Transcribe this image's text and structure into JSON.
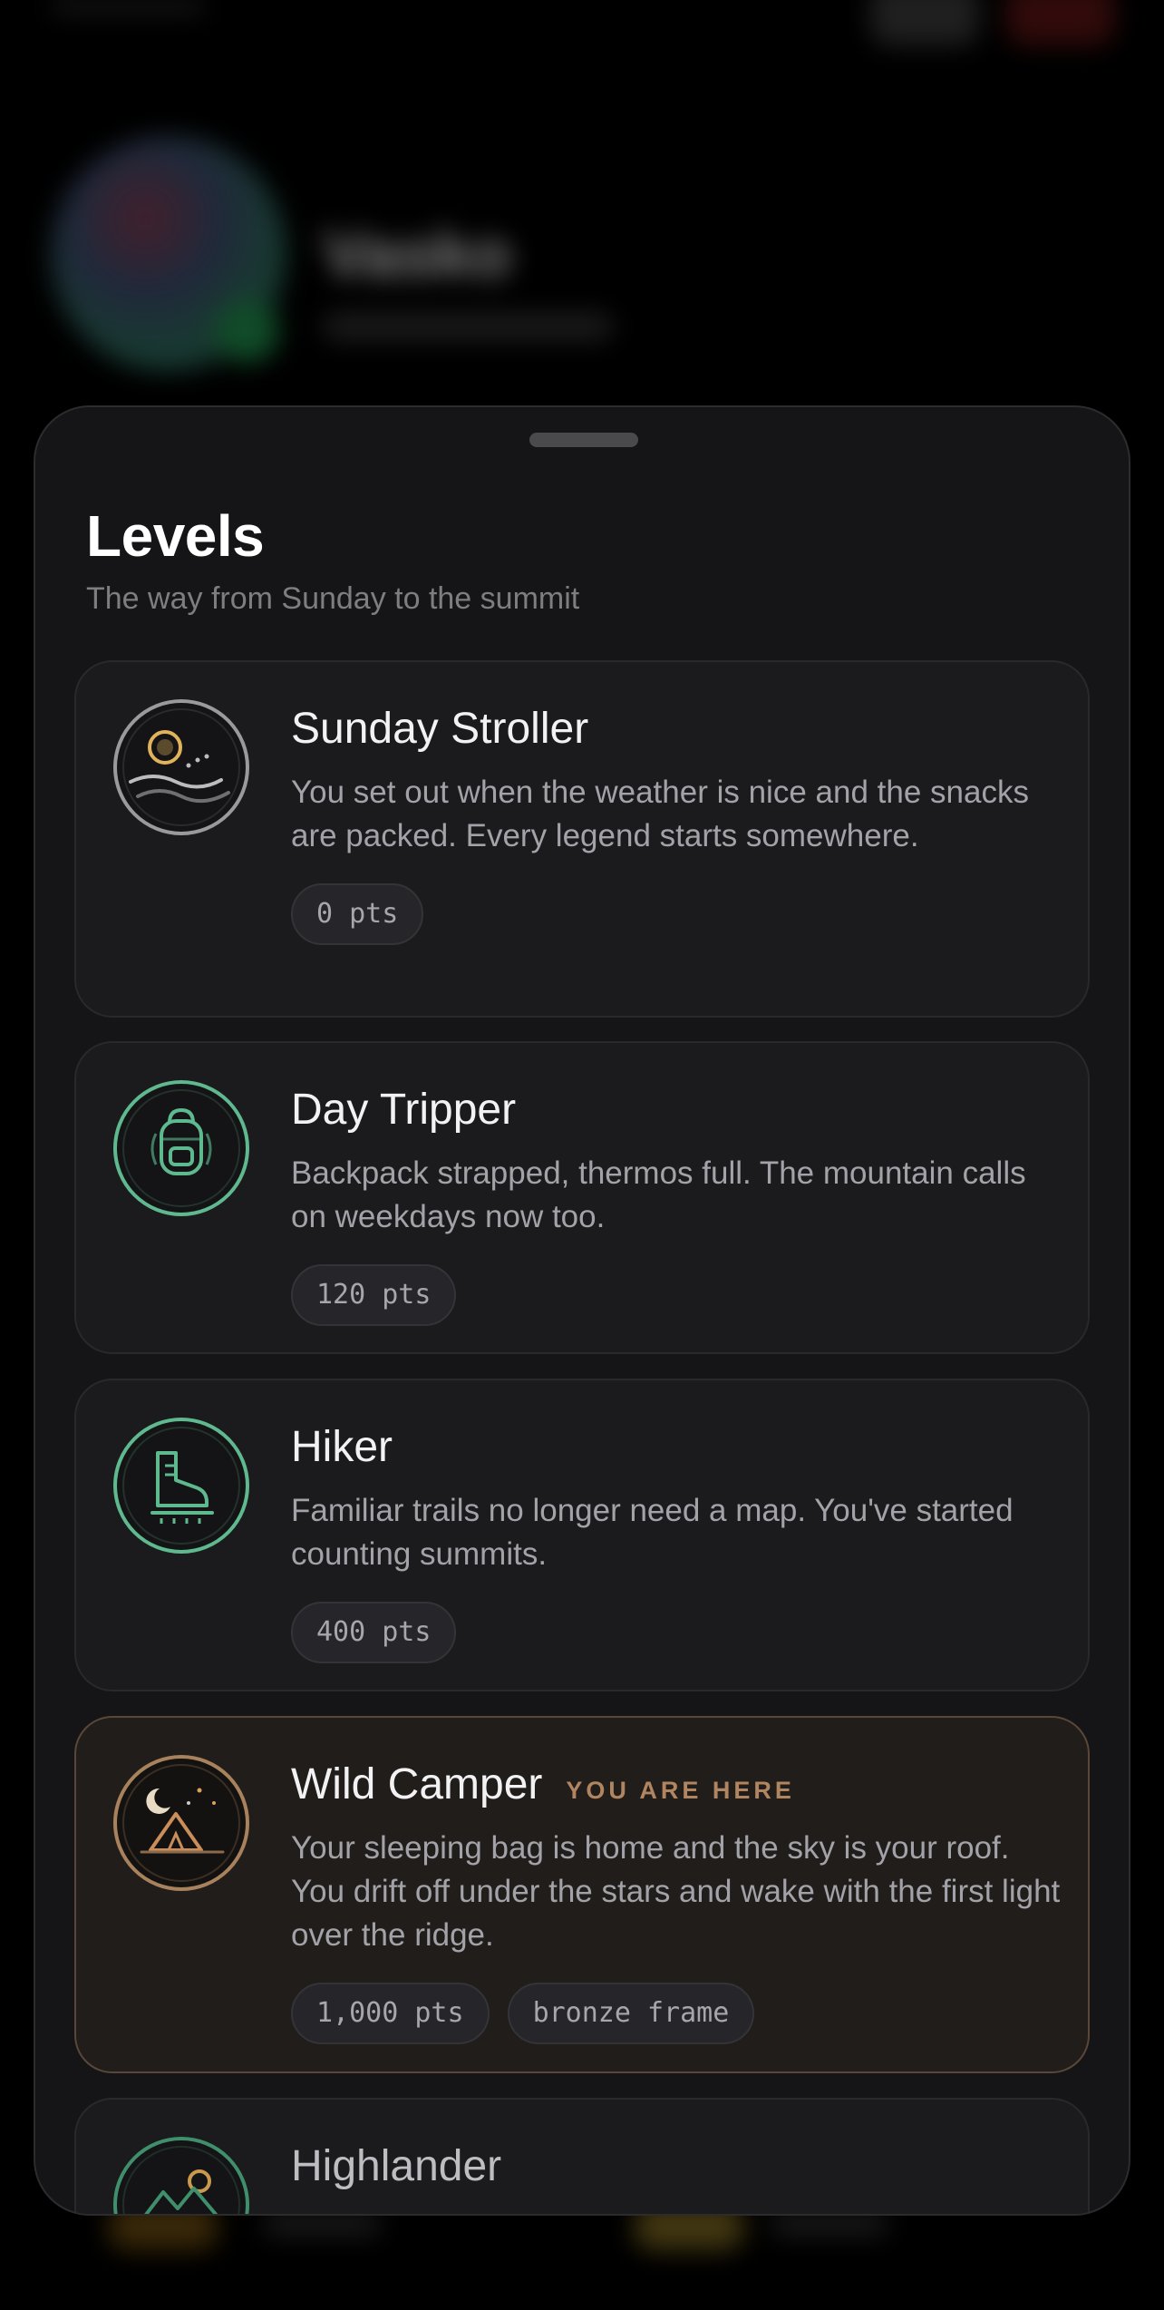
{
  "background": {
    "profile_name": "Vasko"
  },
  "sheet": {
    "title": "Levels",
    "subtitle": "The way from Sunday to the summit"
  },
  "levels": [
    {
      "title": "Sunday Stroller",
      "description": "You set out when the weather is nice and the snacks are packed. Every legend starts somewhere.",
      "points": "0 pts",
      "icon": "sun-over-waves-icon",
      "ring_color": "#9a9a9e"
    },
    {
      "title": "Day Tripper",
      "description": "Backpack strapped, thermos full. The mountain calls on weekdays now too.",
      "points": "120 pts",
      "icon": "backpack-icon",
      "ring_color": "#5fb98f"
    },
    {
      "title": "Hiker",
      "description": "Familiar trails no longer need a map. You've started counting summits.",
      "points": "400 pts",
      "icon": "hiking-boot-icon",
      "ring_color": "#5fb98f"
    },
    {
      "title": "Wild Camper",
      "current_tag": "YOU ARE HERE",
      "description": "Your sleeping bag is home and the sky is your roof. You drift off under the stars and wake with the first light over the ridge.",
      "points": "1,000 pts",
      "reward": "bronze frame",
      "icon": "tent-under-moon-icon",
      "ring_color": "#a8825c"
    },
    {
      "title": "Highlander",
      "icon": "mountain-sun-icon",
      "ring_color": "#3f8f6c"
    }
  ]
}
